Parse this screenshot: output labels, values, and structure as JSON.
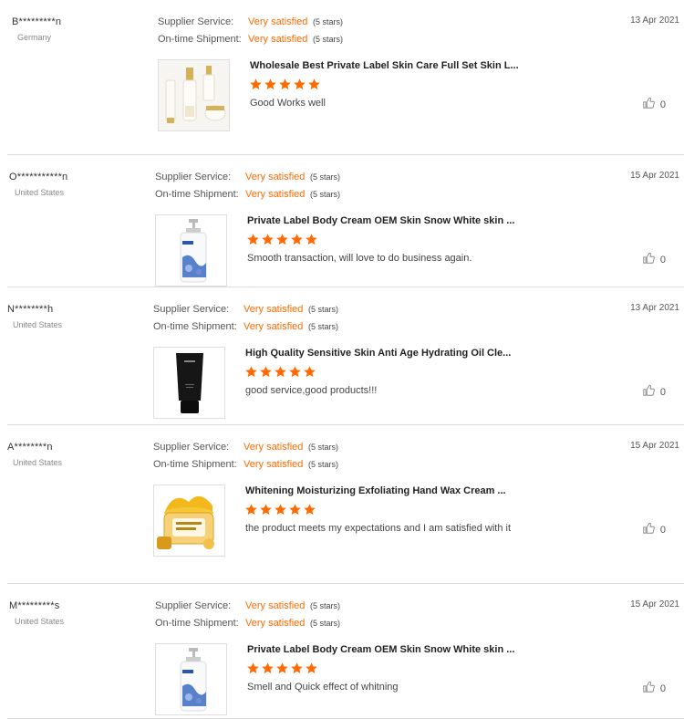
{
  "labels": {
    "supplier_service": "Supplier Service:",
    "on_time_shipment": "On-time Shipment:"
  },
  "colors": {
    "accent": "#ff6a00",
    "divider": "#dcdcdc"
  },
  "reviews": [
    {
      "buyer": "B*********n",
      "country": "Germany",
      "date": "13 Apr 2021",
      "supplier_value": "Very satisfied",
      "supplier_stars": "(5 stars)",
      "shipment_value": "Very satisfied",
      "shipment_stars": "(5 stars)",
      "product_title": "Wholesale Best Private Label Skin Care Full Set Skin L...",
      "rating": 5,
      "comment": "Good Works well",
      "likes": "0",
      "product_image": "skin-care-set"
    },
    {
      "buyer": "O***********n",
      "country": "United States",
      "date": "15 Apr 2021",
      "supplier_value": "Very satisfied",
      "supplier_stars": "(5 stars)",
      "shipment_value": "Very satisfied",
      "shipment_stars": "(5 stars)",
      "product_title": "Private Label Body Cream OEM Skin Snow White skin ...",
      "rating": 5,
      "comment": "Smooth transaction, will love to do business again.",
      "likes": "0",
      "product_image": "pump-bottle"
    },
    {
      "buyer": "N********h",
      "country": "United States",
      "date": "13 Apr 2021",
      "supplier_value": "Very satisfied",
      "supplier_stars": "(5 stars)",
      "shipment_value": "Very satisfied",
      "shipment_stars": "(5 stars)",
      "product_title": "High Quality Sensitive Skin Anti Age Hydrating Oil Cle...",
      "rating": 5,
      "comment": "good service,good products!!!",
      "likes": "0",
      "product_image": "black-tube"
    },
    {
      "buyer": "A********n",
      "country": "United States",
      "date": "15 Apr 2021",
      "supplier_value": "Very satisfied",
      "supplier_stars": "(5 stars)",
      "shipment_value": "Very satisfied",
      "shipment_stars": "(5 stars)",
      "product_title": "Whitening Moisturizing Exfoliating Hand Wax Cream ...",
      "rating": 5,
      "comment": "the product meets my expectations and I am satisfied with it",
      "likes": "0",
      "product_image": "hand-wax-jar"
    },
    {
      "buyer": "M*********s",
      "country": "United States",
      "date": "15 Apr 2021",
      "supplier_value": "Very satisfied",
      "supplier_stars": "(5 stars)",
      "shipment_value": "Very satisfied",
      "shipment_stars": "(5 stars)",
      "product_title": "Private Label Body Cream OEM Skin Snow White skin ...",
      "rating": 5,
      "comment": "Smell and  Quick effect of whitning",
      "likes": "0",
      "product_image": "pump-bottle"
    }
  ]
}
